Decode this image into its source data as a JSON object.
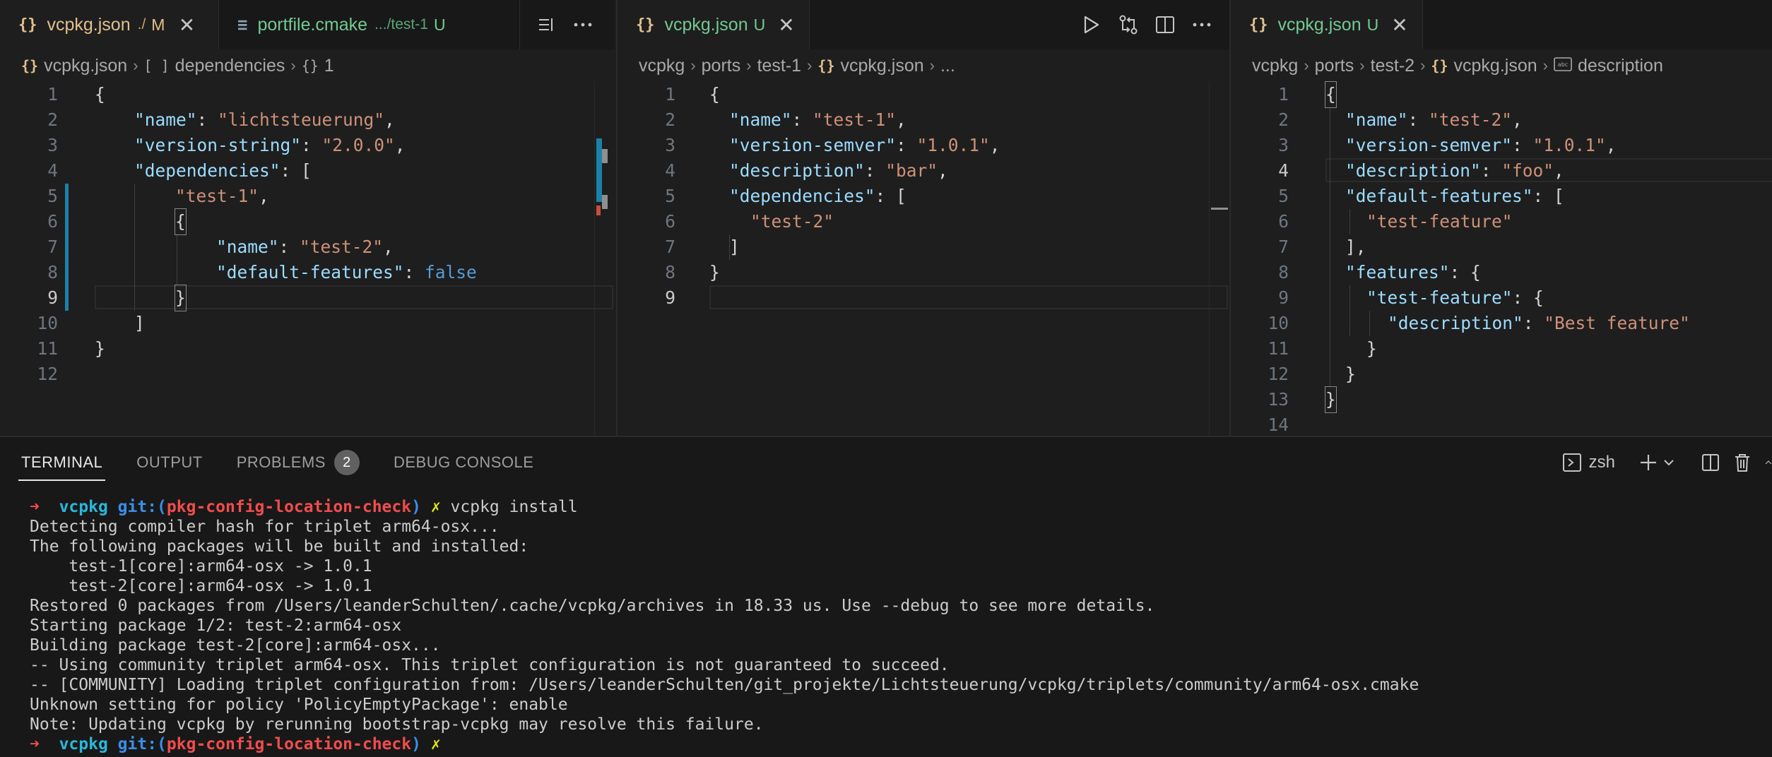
{
  "editor1": {
    "tabs": [
      {
        "icon": "{}",
        "name": "vcpkg.json",
        "desc": "./",
        "status": "M",
        "close": "✕"
      },
      {
        "icon": "≡",
        "name": "portfile.cmake",
        "desc": ".../test-1",
        "status": "U"
      }
    ],
    "breadcrumbs": [
      "vcpkg.json",
      "dependencies",
      "1"
    ],
    "breadcrumb_icons": [
      "{}",
      "[ ]",
      "{}"
    ],
    "line_numbers": [
      "1",
      "2",
      "3",
      "4",
      "5",
      "6",
      "7",
      "8",
      "9",
      "10",
      "11",
      "12"
    ],
    "code": {
      "l1": "{",
      "l2_key": "\"name\"",
      "l2_val": "\"lichtsteuerung\"",
      "l3_key": "\"version-string\"",
      "l3_val": "\"2.0.0\"",
      "l4_key": "\"dependencies\"",
      "l4_open": "[",
      "l5_val": "\"test-1\"",
      "l6": "{",
      "l7_key": "\"name\"",
      "l7_val": "\"test-2\"",
      "l8_key": "\"default-features\"",
      "l8_val": "false",
      "l9": "}",
      "l10": "]",
      "l11": "}"
    }
  },
  "editor2": {
    "tab": {
      "icon": "{}",
      "name": "vcpkg.json",
      "status": "U",
      "close": "✕"
    },
    "breadcrumbs": [
      "vcpkg",
      "ports",
      "test-1",
      "vcpkg.json",
      "..."
    ],
    "line_numbers": [
      "1",
      "2",
      "3",
      "4",
      "5",
      "6",
      "7",
      "8",
      "9"
    ],
    "code": {
      "l1": "{",
      "l2_key": "\"name\"",
      "l2_val": "\"test-1\"",
      "l3_key": "\"version-semver\"",
      "l3_val": "\"1.0.1\"",
      "l4_key": "\"description\"",
      "l4_val": "\"bar\"",
      "l5_key": "\"dependencies\"",
      "l5_open": "[",
      "l6_val": "\"test-2\"",
      "l7": "]",
      "l8": "}"
    }
  },
  "editor3": {
    "tab": {
      "icon": "{}",
      "name": "vcpkg.json",
      "status": "U",
      "close": "✕"
    },
    "breadcrumbs": [
      "vcpkg",
      "ports",
      "test-2",
      "vcpkg.json",
      "description"
    ],
    "line_numbers": [
      "1",
      "2",
      "3",
      "4",
      "5",
      "6",
      "7",
      "8",
      "9",
      "10",
      "11",
      "12",
      "13",
      "14"
    ],
    "code": {
      "l1": "{",
      "l2_key": "\"name\"",
      "l2_val": "\"test-2\"",
      "l3_key": "\"version-semver\"",
      "l3_val": "\"1.0.1\"",
      "l4_key": "\"description\"",
      "l4_val": "\"foo\"",
      "l5_key": "\"default-features\"",
      "l5_open": "[",
      "l6_val": "\"test-feature\"",
      "l7": "],",
      "l8_key": "\"features\"",
      "l8_open": "{",
      "l9_key": "\"test-feature\"",
      "l9_open": "{",
      "l10_key": "\"description\"",
      "l10_val": "\"Best feature\"",
      "l11": "}",
      "l12": "}",
      "l13": "}"
    }
  },
  "panel": {
    "tabs": [
      "TERMINAL",
      "OUTPUT",
      "PROBLEMS",
      "DEBUG CONSOLE"
    ],
    "problems_count": "2",
    "shell": "zsh"
  },
  "terminal": {
    "prompt_arrow": "➜",
    "prompt_dir": "vcpkg",
    "prompt_git": "git:(",
    "prompt_branch": "pkg-config-location-check",
    "prompt_git_close": ")",
    "prompt_dirty": "✗",
    "command": "vcpkg install",
    "output": [
      "Detecting compiler hash for triplet arm64-osx...",
      "The following packages will be built and installed:",
      "    test-1[core]:arm64-osx -> 1.0.1",
      "    test-2[core]:arm64-osx -> 1.0.1",
      "Restored 0 packages from /Users/leanderSchulten/.cache/vcpkg/archives in 18.33 us. Use --debug to see more details.",
      "Starting package 1/2: test-2:arm64-osx",
      "Building package test-2[core]:arm64-osx...",
      "-- Using community triplet arm64-osx. This triplet configuration is not guaranteed to succeed.",
      "-- [COMMUNITY] Loading triplet configuration from: /Users/leanderSchulten/git_projekte/Lichtsteuerung/vcpkg/triplets/community/arm64-osx.cmake",
      "Unknown setting for policy 'PolicyEmptyPackage': enable",
      "Note: Updating vcpkg by rerunning bootstrap-vcpkg may resolve this failure."
    ]
  },
  "colors": {
    "editor_bg": "#1e1e1e",
    "tabbar_bg": "#181818",
    "json_key": "#9cdcfe",
    "json_string": "#ce9178",
    "json_keyword": "#569cd6",
    "modified": "#e2c08d",
    "untracked": "#73c991"
  },
  "icons": {
    "run": "play-icon",
    "compare": "git-compare-icon",
    "split": "split-editor-icon",
    "more": "ellipsis-icon",
    "terminal": "terminal-icon",
    "add": "plus-icon",
    "trash": "trash-icon"
  }
}
